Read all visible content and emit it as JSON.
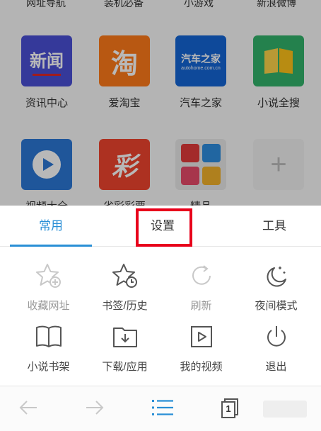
{
  "home": {
    "top_row": [
      "网址导航",
      "装机必备",
      "小游戏",
      "新浪微博"
    ],
    "apps": [
      {
        "label": "资讯中心",
        "icon": "news-icon",
        "icon_text": "新闻"
      },
      {
        "label": "爱淘宝",
        "icon": "taobao-icon",
        "icon_text": "淘"
      },
      {
        "label": "汽车之家",
        "icon": "autohome-icon",
        "icon_text": "汽车之家",
        "icon_subtext": "autohome.com.cn"
      },
      {
        "label": "小说全搜",
        "icon": "book-icon",
        "icon_text": ""
      },
      {
        "label": "视频大全",
        "icon": "video-play-icon",
        "icon_text": ""
      },
      {
        "label": "省彩彩票",
        "icon": "lottery-icon",
        "icon_text": "彩"
      },
      {
        "label": "精品",
        "icon": "featured-apps-icon",
        "icon_text": ""
      },
      {
        "label": "",
        "icon": "add-icon",
        "icon_text": "+"
      }
    ]
  },
  "menu": {
    "tabs": [
      {
        "label": "常用",
        "active": true
      },
      {
        "label": "设置",
        "active": false
      },
      {
        "label": "工具",
        "active": false
      }
    ],
    "items": [
      {
        "label": "收藏网址",
        "icon": "star-add-icon",
        "enabled": false
      },
      {
        "label": "书签/历史",
        "icon": "star-clock-icon",
        "enabled": true
      },
      {
        "label": "刷新",
        "icon": "refresh-icon",
        "enabled": false
      },
      {
        "label": "夜间模式",
        "icon": "moon-stars-icon",
        "enabled": true
      },
      {
        "label": "小说书架",
        "icon": "open-book-icon",
        "enabled": true
      },
      {
        "label": "下载/应用",
        "icon": "download-folder-icon",
        "enabled": true
      },
      {
        "label": "我的视频",
        "icon": "video-file-icon",
        "enabled": true
      },
      {
        "label": "退出",
        "icon": "power-icon",
        "enabled": true
      }
    ]
  },
  "bottom_bar": {
    "tab_count": "1",
    "icons": [
      "back-arrow-icon",
      "forward-arrow-icon",
      "menu-list-icon",
      "tabs-icon"
    ]
  },
  "colors": {
    "accent": "#2a8fd6",
    "highlight_box": "#e8001b"
  }
}
